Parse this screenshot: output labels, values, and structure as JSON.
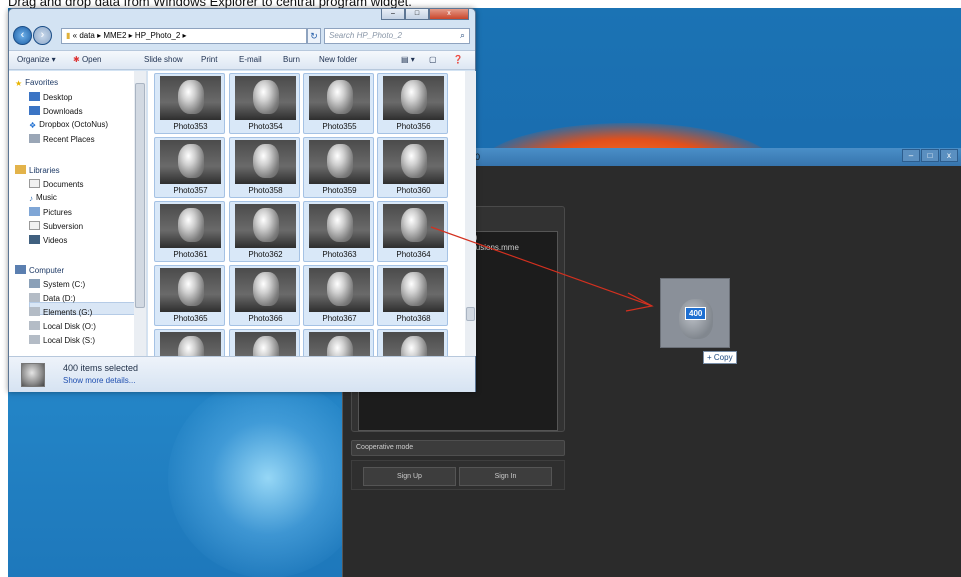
{
  "caption": "Drag and drop data from Windows Explorer to central program widget.",
  "explorer": {
    "path": "« data ▸ MME2 ▸ HP_Photo_2 ▸",
    "search_placeholder": "Search HP_Photo_2",
    "toolbar": {
      "organize": "Organize ▾",
      "open": "Open",
      "slideshow": "Slide show",
      "print": "Print",
      "email": "E-mail",
      "burn": "Burn",
      "new_folder": "New folder"
    },
    "nav": {
      "favorites": "Favorites",
      "desktop": "Desktop",
      "downloads": "Downloads",
      "dropbox": "Dropbox (OctoNus)",
      "recent": "Recent Places",
      "libraries": "Libraries",
      "documents": "Documents",
      "music": "Music",
      "pictures": "Pictures",
      "subversion": "Subversion",
      "videos": "Videos",
      "computer": "Computer",
      "system_c": "System (C:)",
      "data_d": "Data (D:)",
      "elements_g": "Elements (G:)",
      "local_o": "Local Disk (O:)",
      "local_s": "Local Disk (S:)"
    },
    "photos": [
      "Photo353",
      "Photo354",
      "Photo355",
      "Photo356",
      "Photo357",
      "Photo358",
      "Photo359",
      "Photo360",
      "Photo361",
      "Photo362",
      "Photo363",
      "Photo364",
      "Photo365",
      "Photo366",
      "Photo367",
      "Photo368"
    ],
    "details": {
      "count": "400 items selected",
      "more": "Show more details..."
    }
  },
  "app": {
    "title_fragment": "a20",
    "panel_line1": "=)",
    "panel_line2": "clusions.mme",
    "coop_header": "Cooperative mode",
    "signup": "Sign Up",
    "signin": "Sign In"
  },
  "drag": {
    "badge": "400",
    "tip": "Copy"
  }
}
